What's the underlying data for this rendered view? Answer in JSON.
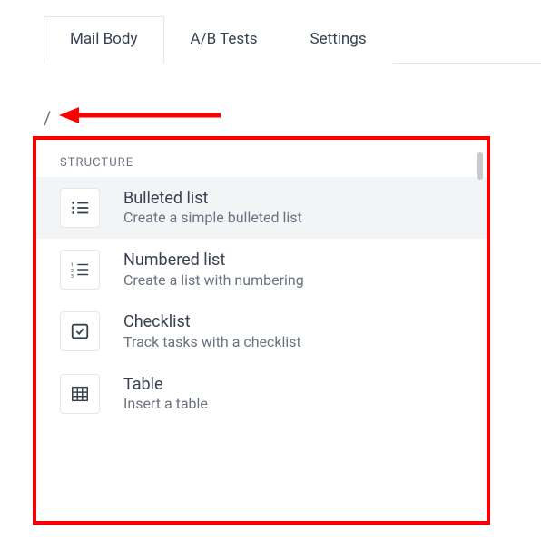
{
  "tabs": [
    {
      "label": "Mail Body",
      "active": true
    },
    {
      "label": "A/B Tests",
      "active": false
    },
    {
      "label": "Settings",
      "active": false
    }
  ],
  "trigger_char": "/",
  "menu": {
    "section_label": "STRUCTURE",
    "items": [
      {
        "icon": "bulleted-list-icon",
        "title": "Bulleted list",
        "desc": "Create a simple bulleted list",
        "selected": true
      },
      {
        "icon": "numbered-list-icon",
        "title": "Numbered list",
        "desc": "Create a list with numbering",
        "selected": false
      },
      {
        "icon": "checklist-icon",
        "title": "Checklist",
        "desc": "Track tasks with a checklist",
        "selected": false
      },
      {
        "icon": "table-icon",
        "title": "Table",
        "desc": "Insert a table",
        "selected": false
      }
    ]
  }
}
